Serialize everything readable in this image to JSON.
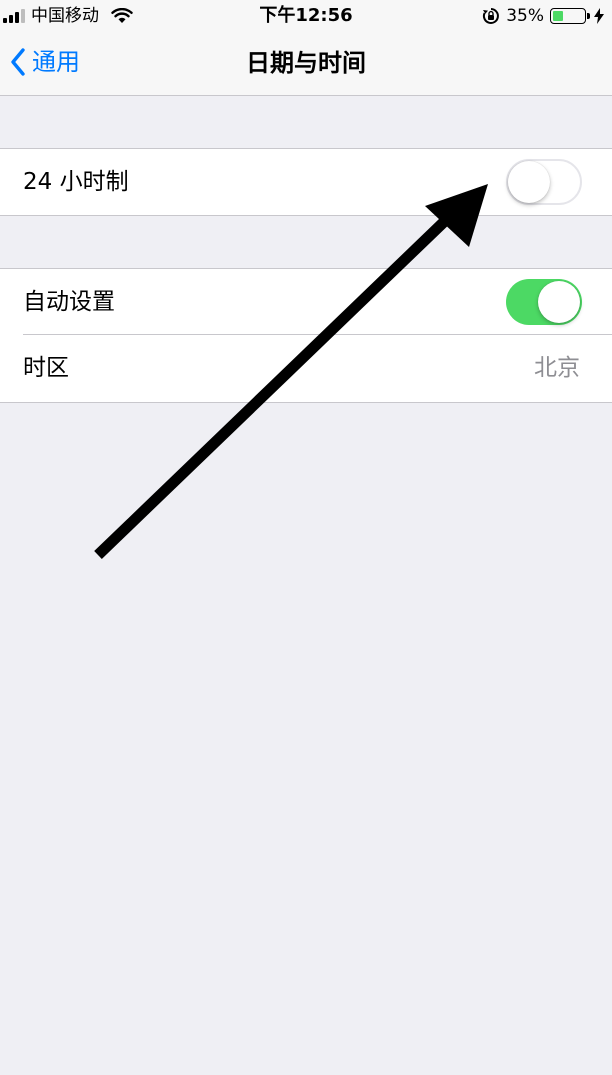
{
  "status_bar": {
    "carrier": "中国移动",
    "time": "下午12:56",
    "battery_percent_label": "35%",
    "battery_level": 0.35,
    "battery_color": "#4cd964"
  },
  "nav": {
    "back_label": "通用",
    "title": "日期与时间"
  },
  "settings": {
    "hour24": {
      "label": "24 小时制",
      "enabled": false
    },
    "auto_set": {
      "label": "自动设置",
      "enabled": true
    },
    "time_zone": {
      "label": "时区",
      "value": "北京"
    }
  },
  "colors": {
    "accent": "#007aff",
    "toggle_on": "#4cd964",
    "background": "#efeff4",
    "annotation": "#000000"
  },
  "icons": {
    "signal": "cellular-signal-icon",
    "wifi": "wifi-icon",
    "orientation_lock": "orientation-lock-icon",
    "battery": "battery-icon",
    "charging": "charging-bolt-icon",
    "back": "chevron-left-icon",
    "annotation": "arrow-annotation-icon"
  }
}
